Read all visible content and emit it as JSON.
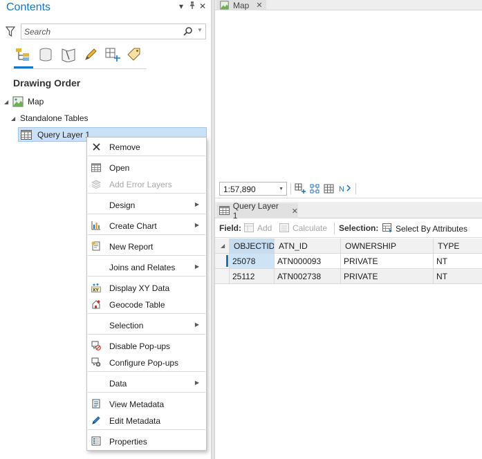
{
  "contents": {
    "title": "Contents",
    "search_placeholder": "Search",
    "drawing_order": "Drawing Order",
    "tree": {
      "map_label": "Map",
      "standalone_label": "Standalone Tables",
      "query_layer_label": "Query Layer 1"
    }
  },
  "context_menu": {
    "items": [
      {
        "label": "Remove",
        "icon": "close-icon"
      },
      {
        "label": "Open",
        "icon": "table-icon"
      },
      {
        "label": "Add Error Layers",
        "icon": "layers-icon",
        "disabled": true
      },
      {
        "label": "Design",
        "submenu": true
      },
      {
        "label": "Create Chart",
        "icon": "bar-chart-icon",
        "submenu": true
      },
      {
        "label": "New Report",
        "icon": "report-icon"
      },
      {
        "label": "Joins and Relates",
        "submenu": true
      },
      {
        "label": "Display XY Data",
        "icon": "xy-data-icon"
      },
      {
        "label": "Geocode Table",
        "icon": "geocode-icon"
      },
      {
        "label": "Selection",
        "submenu": true
      },
      {
        "label": "Disable Pop-ups",
        "icon": "disable-popups-icon"
      },
      {
        "label": "Configure Pop-ups",
        "icon": "configure-popups-icon"
      },
      {
        "label": "Data",
        "submenu": true
      },
      {
        "label": "View Metadata",
        "icon": "metadata-icon"
      },
      {
        "label": "Edit Metadata",
        "icon": "pencil-icon"
      },
      {
        "label": "Properties",
        "icon": "properties-icon"
      }
    ]
  },
  "map_view": {
    "tab_label": "Map",
    "scale": "1:57,890"
  },
  "table_view": {
    "tab_label": "Query Layer 1",
    "toolbar": {
      "field_label": "Field:",
      "add_label": "Add",
      "calculate_label": "Calculate",
      "selection_label": "Selection:",
      "select_by_attributes_label": "Select By Attributes"
    },
    "columns": [
      "OBJECTID",
      "ATN_ID",
      "OWNERSHIP",
      "TYPE"
    ],
    "rows": [
      [
        "25078",
        "ATN000093",
        "PRIVATE",
        "NT"
      ],
      [
        "25112",
        "ATN002738",
        "PRIVATE",
        "NT"
      ]
    ]
  },
  "colors": {
    "accent": "#1a73bf",
    "selection": "#cbe2f6"
  }
}
